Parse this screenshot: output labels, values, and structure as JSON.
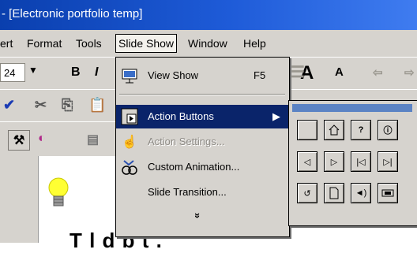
{
  "window": {
    "title": "- [Electronic portfolio temp]"
  },
  "menubar": {
    "items": [
      "ert",
      "Format",
      "Tools",
      "Slide Show",
      "Window",
      "Help"
    ]
  },
  "toolbar": {
    "font_size": "24",
    "bold": "B",
    "italic": "I",
    "grow_font": "A",
    "shrink_font": "A"
  },
  "slideshow_menu": {
    "items": [
      {
        "label": "View Show",
        "shortcut": "F5",
        "icon": "projector-icon"
      },
      {
        "label": "Action Buttons",
        "shortcut": "",
        "icon": "action-button-icon",
        "highlighted": true,
        "submenu": true
      },
      {
        "label": "Action Settings...",
        "shortcut": "",
        "icon": "hand-icon",
        "disabled": true
      },
      {
        "label": "Custom Animation...",
        "shortcut": "",
        "icon": "animation-icon"
      },
      {
        "label": "Slide Transition...",
        "shortcut": "",
        "icon": ""
      }
    ],
    "more": "»"
  },
  "action_buttons_submenu": {
    "buttons": [
      "custom",
      "home",
      "help",
      "information",
      "back",
      "forward",
      "beginning",
      "end",
      "return",
      "document",
      "sound",
      "movie"
    ]
  },
  "slide": {
    "text": "T  l  d  b  t  ."
  },
  "colors": {
    "title_bar": "#0a3fae",
    "menu_highlight": "#0a246a",
    "chrome": "#d6d3ce"
  }
}
